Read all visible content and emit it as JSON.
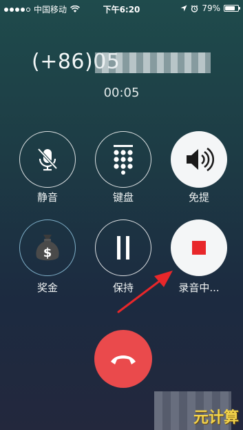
{
  "status_bar": {
    "carrier": "中国移动",
    "time": "下午6:20",
    "battery_percent": "79%",
    "battery_level": 0.79,
    "signal_bars_filled": 4,
    "signal_bars_total": 5,
    "icons": [
      "signal-dots-icon",
      "wifi-icon",
      "location-arrow-icon",
      "alarm-icon",
      "battery-icon"
    ]
  },
  "call": {
    "number_visible": "(+86)05",
    "timer": "00:05"
  },
  "controls": [
    {
      "label": "静音",
      "icon": "mute-microphone-icon",
      "active": false
    },
    {
      "label": "键盘",
      "icon": "keypad-icon",
      "active": false
    },
    {
      "label": "免提",
      "icon": "speaker-icon",
      "active": true
    },
    {
      "label": "奖金",
      "icon": "money-bag-icon",
      "active": false
    },
    {
      "label": "保持",
      "icon": "pause-icon",
      "active": false
    },
    {
      "label": "录音中...",
      "icon": "record-stop-icon",
      "active": true
    }
  ],
  "end_call": {
    "icon": "hang-up-icon",
    "color": "#ea4a4c"
  },
  "annotation": {
    "icon": "red-arrow-icon",
    "color": "#e8272a"
  },
  "watermark": {
    "text": "元计算"
  },
  "colors": {
    "record_red": "#e8272a",
    "bonus_ring": "#7fb0c9",
    "watermark_yellow": "#f2d34b"
  }
}
